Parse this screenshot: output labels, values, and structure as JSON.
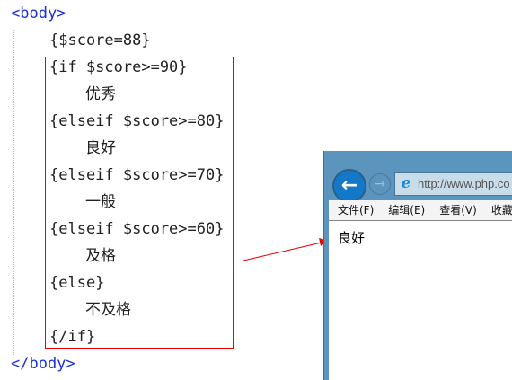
{
  "code": [
    {
      "indent": 0,
      "text": "<body>",
      "kind": "tag"
    },
    {
      "indent": 1,
      "text": "{$score=88}",
      "kind": "code"
    },
    {
      "indent": 1,
      "text": "{if $score>=90}",
      "kind": "code"
    },
    {
      "indent": 2,
      "text": "优秀",
      "kind": "code"
    },
    {
      "indent": 1,
      "text": "{elseif $score>=80}",
      "kind": "code"
    },
    {
      "indent": 2,
      "text": "良好",
      "kind": "code"
    },
    {
      "indent": 1,
      "text": "{elseif $score>=70}",
      "kind": "code"
    },
    {
      "indent": 2,
      "text": "一般",
      "kind": "code"
    },
    {
      "indent": 1,
      "text": "{elseif $score>=60}",
      "kind": "code"
    },
    {
      "indent": 2,
      "text": "及格",
      "kind": "code"
    },
    {
      "indent": 1,
      "text": "{else}",
      "kind": "code"
    },
    {
      "indent": 2,
      "text": "不及格",
      "kind": "code"
    },
    {
      "indent": 1,
      "text": "{/if}",
      "kind": "code"
    },
    {
      "indent": 0,
      "text": "</body>",
      "kind": "tag"
    }
  ],
  "browser": {
    "back_icon": "←",
    "forward_icon": "→",
    "ie_icon": "e",
    "address": "http://www.php.co",
    "menu": [
      "文件(F)",
      "编辑(E)",
      "查看(V)",
      "收藏夹"
    ],
    "content": "良好"
  },
  "colors": {
    "annotation": "#e00000",
    "tag": "#1a2fd6"
  }
}
